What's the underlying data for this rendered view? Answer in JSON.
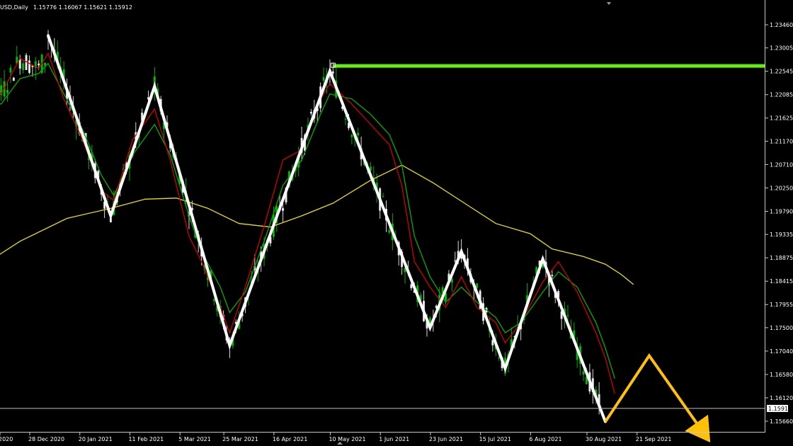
{
  "header": {
    "symbol_period": "USD,Daily",
    "ohlc": "1.15776 1.16067 1.15621 1.15912"
  },
  "colors": {
    "background": "#000000",
    "frame": "#c8c8c8",
    "bull_candle": "#00cc00",
    "bear_candle": "#ffffff",
    "ma_fast": "#d00000",
    "ma_mid": "#00b000",
    "ma_slow": "#e8e000",
    "zigzag": "#ffffff",
    "resistance": "#66ee11",
    "projection": "#ffc107",
    "price_line": "#c0c0c0"
  },
  "chart_data": {
    "type": "line",
    "title": "",
    "instrument_label": "USD,Daily",
    "ylim": [
      1.1535,
      1.2375
    ],
    "price_axis_ticks": [
      1.2346,
      1.23005,
      1.22545,
      1.22085,
      1.21625,
      1.2117,
      1.2071,
      1.2025,
      1.1979,
      1.19335,
      1.18875,
      1.18415,
      1.17955,
      1.175,
      1.1704,
      1.1658,
      1.1612,
      1.1566
    ],
    "price_axis_labels": [
      "1.23460",
      "1.23005",
      "1.22545",
      "1.22085",
      "1.21625",
      "1.21170",
      "1.20710",
      "1.20250",
      "1.19790",
      "1.19335",
      "1.18875",
      "1.18415",
      "1.17955",
      "1.17500",
      "1.17040",
      "1.16580",
      "1.16120",
      "1.15660"
    ],
    "current_price": 1.15912,
    "current_price_label": "1.15912",
    "date_labels": [
      "2020",
      "28 Dec 2020",
      "20 Jan 2021",
      "11 Feb 2021",
      "5 Mar 2021",
      "25 Mar 2021",
      "16 Apr 2021",
      "10 May 2021",
      "1 Jun 2021",
      "23 Jun 2021",
      "15 Jul 2021",
      "6 Aug 2021",
      "30 Aug 2021",
      "21 Sep 2021"
    ],
    "date_label_bar_index": [
      -1,
      9,
      25,
      41,
      57,
      71,
      87,
      105,
      121,
      137,
      153,
      169,
      187,
      203
    ],
    "series": [
      {
        "kind": "zigzag",
        "points": [
          [
            9,
            1.2325
          ],
          [
            29,
            1.197
          ],
          [
            43,
            1.2225
          ],
          [
            67,
            1.1715
          ],
          [
            99,
            1.2255
          ],
          [
            131,
            1.175
          ],
          [
            141,
            1.19
          ],
          [
            155,
            1.167
          ],
          [
            167,
            1.1885
          ],
          [
            187,
            1.1565
          ]
        ]
      },
      {
        "kind": "projection",
        "points": [
          [
            187,
            1.1565
          ],
          [
            201,
            1.1695
          ],
          [
            217,
            1.1555
          ]
        ],
        "arrow": "down-right"
      },
      {
        "kind": "resistance",
        "price": 1.2265,
        "from_bar": 100
      },
      {
        "kind": "ma_slow",
        "points": [
          [
            -30,
            1.178
          ],
          [
            -15,
            1.186
          ],
          [
            0,
            1.192
          ],
          [
            15,
            1.1965
          ],
          [
            29,
            1.1985
          ],
          [
            40,
            1.2003
          ],
          [
            50,
            1.2005
          ],
          [
            60,
            1.1985
          ],
          [
            70,
            1.1955
          ],
          [
            80,
            1.1948
          ],
          [
            90,
            1.197
          ],
          [
            100,
            1.1995
          ],
          [
            112,
            1.204
          ],
          [
            122,
            1.207
          ],
          [
            132,
            1.2035
          ],
          [
            142,
            1.1995
          ],
          [
            152,
            1.1955
          ],
          [
            163,
            1.1935
          ],
          [
            170,
            1.1905
          ],
          [
            180,
            1.189
          ],
          [
            187,
            1.1875
          ],
          [
            192,
            1.1855
          ],
          [
            196,
            1.1835
          ]
        ]
      },
      {
        "kind": "ma_fast",
        "points": [
          [
            -30,
            1.218
          ],
          [
            -24,
            1.223
          ],
          [
            -18,
            1.219
          ],
          [
            -12,
            1.224
          ],
          [
            -6,
            1.221
          ],
          [
            0,
            1.228
          ],
          [
            6,
            1.226
          ],
          [
            9,
            1.229
          ],
          [
            14,
            1.22
          ],
          [
            20,
            1.212
          ],
          [
            26,
            1.202
          ],
          [
            30,
            1.2
          ],
          [
            36,
            1.212
          ],
          [
            43,
            1.218
          ],
          [
            48,
            1.208
          ],
          [
            54,
            1.193
          ],
          [
            58,
            1.188
          ],
          [
            64,
            1.179
          ],
          [
            67,
            1.174
          ],
          [
            72,
            1.183
          ],
          [
            78,
            1.195
          ],
          [
            84,
            1.208
          ],
          [
            90,
            1.21
          ],
          [
            96,
            1.22
          ],
          [
            99,
            1.223
          ],
          [
            106,
            1.219
          ],
          [
            112,
            1.215
          ],
          [
            118,
            1.211
          ],
          [
            122,
            1.203
          ],
          [
            126,
            1.188
          ],
          [
            131,
            1.183
          ],
          [
            136,
            1.179
          ],
          [
            141,
            1.185
          ],
          [
            146,
            1.179
          ],
          [
            152,
            1.176
          ],
          [
            155,
            1.172
          ],
          [
            160,
            1.176
          ],
          [
            167,
            1.184
          ],
          [
            172,
            1.188
          ],
          [
            178,
            1.182
          ],
          [
            184,
            1.174
          ],
          [
            187,
            1.169
          ],
          [
            190,
            1.162
          ]
        ]
      },
      {
        "kind": "ma_mid",
        "points": [
          [
            -30,
            1.213
          ],
          [
            -24,
            1.218
          ],
          [
            -18,
            1.217
          ],
          [
            -12,
            1.22
          ],
          [
            -6,
            1.219
          ],
          [
            0,
            1.224
          ],
          [
            6,
            1.225
          ],
          [
            9,
            1.227
          ],
          [
            14,
            1.221
          ],
          [
            20,
            1.214
          ],
          [
            26,
            1.205
          ],
          [
            30,
            1.201
          ],
          [
            36,
            1.209
          ],
          [
            43,
            1.215
          ],
          [
            48,
            1.209
          ],
          [
            54,
            1.197
          ],
          [
            58,
            1.19
          ],
          [
            64,
            1.183
          ],
          [
            67,
            1.178
          ],
          [
            72,
            1.182
          ],
          [
            78,
            1.192
          ],
          [
            84,
            1.203
          ],
          [
            90,
            1.208
          ],
          [
            96,
            1.217
          ],
          [
            99,
            1.221
          ],
          [
            106,
            1.22
          ],
          [
            112,
            1.217
          ],
          [
            118,
            1.213
          ],
          [
            122,
            1.207
          ],
          [
            126,
            1.193
          ],
          [
            131,
            1.185
          ],
          [
            136,
            1.18
          ],
          [
            141,
            1.183
          ],
          [
            146,
            1.18
          ],
          [
            152,
            1.177
          ],
          [
            155,
            1.174
          ],
          [
            160,
            1.176
          ],
          [
            167,
            1.182
          ],
          [
            172,
            1.186
          ],
          [
            178,
            1.183
          ],
          [
            184,
            1.176
          ],
          [
            187,
            1.171
          ],
          [
            190,
            1.165
          ]
        ]
      }
    ]
  }
}
